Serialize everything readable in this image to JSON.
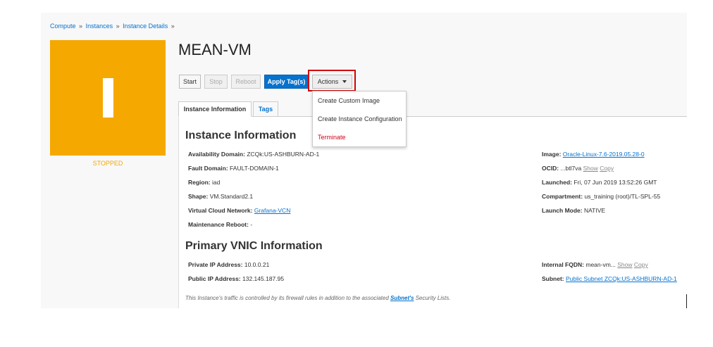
{
  "breadcrumb": {
    "items": [
      "Compute",
      "Instances",
      "Instance Details"
    ],
    "separator": "»"
  },
  "instance": {
    "letter": "I",
    "status": "STOPPED",
    "name": "MEAN-VM"
  },
  "colors": {
    "tile": "#f5a800",
    "primary": "#0572ce",
    "danger": "#d0021b",
    "highlight": "#d40000"
  },
  "buttons": {
    "start": "Start",
    "stop": "Stop",
    "reboot": "Reboot",
    "apply_tags": "Apply Tag(s)",
    "actions": "Actions"
  },
  "actions_menu": {
    "items": [
      "Create Custom Image",
      "Create Instance Configuration",
      "Terminate"
    ]
  },
  "tabs": [
    "Instance Information",
    "Tags"
  ],
  "instance_info": {
    "heading": "Instance Information",
    "left": [
      {
        "label": "Availability Domain:",
        "value": "ZCQk:US-ASHBURN-AD-1"
      },
      {
        "label": "Fault Domain:",
        "value": "FAULT-DOMAIN-1"
      },
      {
        "label": "Region:",
        "value": "iad"
      },
      {
        "label": "Shape:",
        "value": "VM.Standard2.1"
      },
      {
        "label": "Virtual Cloud Network:",
        "value": "Grafana-VCN"
      },
      {
        "label": "Maintenance Reboot:",
        "value": "-"
      }
    ],
    "right": [
      {
        "label": "Image:",
        "value": "Oracle-Linux-7.6-2019.05.28-0"
      },
      {
        "label": "OCID:",
        "value": "...btl7va",
        "show": "Show",
        "copy": "Copy"
      },
      {
        "label": "Launched:",
        "value": "Fri, 07 Jun 2019 13:52:26 GMT"
      },
      {
        "label": "Compartment:",
        "value": "us_training (root)/TL-SPL-55"
      },
      {
        "label": "Launch Mode:",
        "value": "NATIVE"
      }
    ]
  },
  "vnic_info": {
    "heading": "Primary VNIC Information",
    "left": [
      {
        "label": "Private IP Address:",
        "value": "10.0.0.21"
      },
      {
        "label": "Public IP Address:",
        "value": "132.145.187.95"
      }
    ],
    "right": [
      {
        "label": "Internal FQDN:",
        "value": "mean-vm...",
        "show": "Show",
        "copy": "Copy"
      },
      {
        "label": "Subnet:",
        "value": "Public Subnet ZCQk:US-ASHBURN-AD-1"
      }
    ]
  },
  "footnote": {
    "before": "This Instance's traffic is controlled by its firewall rules in addition to the associated ",
    "link": "Subnet's",
    "after": " Security Lists."
  }
}
